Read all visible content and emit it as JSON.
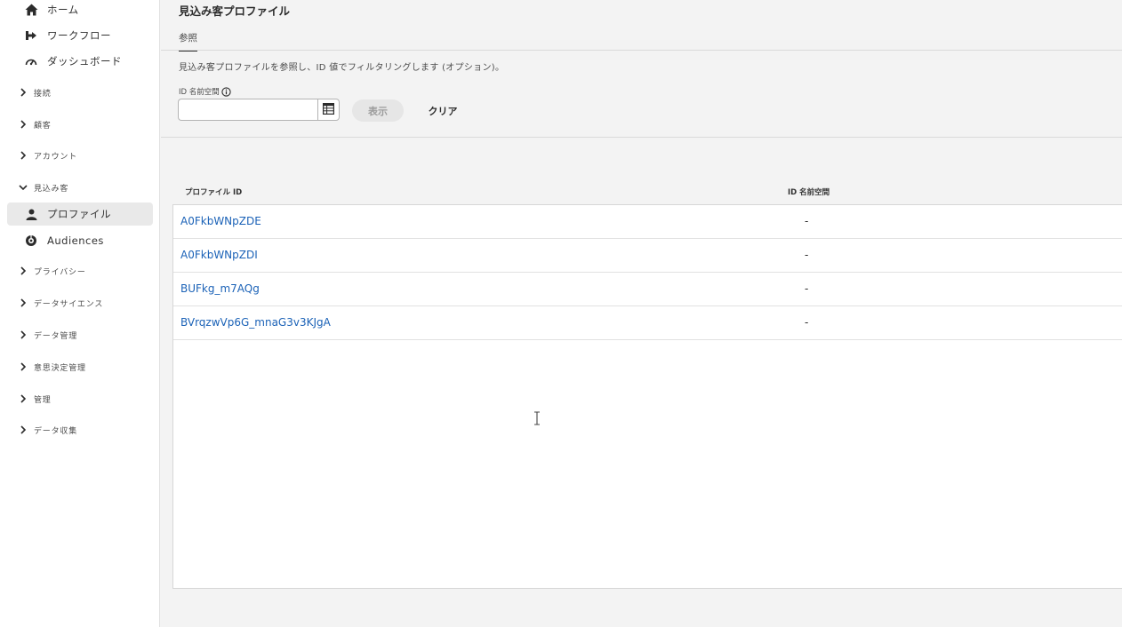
{
  "sidebar": {
    "top_items": [
      {
        "label": "ホーム",
        "icon": "home-icon"
      },
      {
        "label": "ワークフロー",
        "icon": "workflow-icon"
      },
      {
        "label": "ダッシュボード",
        "icon": "dashboard-icon"
      }
    ],
    "groups": [
      {
        "label": "接続",
        "expanded": false
      },
      {
        "label": "顧客",
        "expanded": false
      },
      {
        "label": "アカウント",
        "expanded": false
      },
      {
        "label": "見込み客",
        "expanded": true
      },
      {
        "label": "プライバシー",
        "expanded": false
      },
      {
        "label": "データサイエンス",
        "expanded": false
      },
      {
        "label": "データ管理",
        "expanded": false
      },
      {
        "label": "意思決定管理",
        "expanded": false
      },
      {
        "label": "管理",
        "expanded": false
      },
      {
        "label": "データ収集",
        "expanded": false
      }
    ],
    "sub_items": [
      {
        "label": "プロファイル",
        "icon": "user-icon",
        "selected": true
      },
      {
        "label": "Audiences",
        "icon": "audiences-icon",
        "selected": false
      }
    ]
  },
  "main": {
    "title": "見込み客プロファイル",
    "tab": "参照",
    "description": "見込み客プロファイルを参照し、ID 値でフィルタリングします (オプション)。",
    "filter": {
      "label": "ID 名前空間",
      "input_value": "",
      "show_button": "表示",
      "clear_button": "クリア"
    },
    "table": {
      "columns": [
        "プロファイル ID",
        "ID 名前空間"
      ],
      "rows": [
        {
          "id": "A0FkbWNpZDE",
          "namespace": "-"
        },
        {
          "id": "A0FkbWNpZDI",
          "namespace": "-"
        },
        {
          "id": "BUFkg_m7AQg",
          "namespace": "-"
        },
        {
          "id": "BVrqzwVp6G_mnaG3v3KJgA",
          "namespace": "-"
        }
      ]
    }
  },
  "colors": {
    "link": "#1b62b7",
    "sidebar_bg": "#ffffff",
    "main_bg": "#f3f3f3",
    "selected_bg": "#e9e9e9"
  }
}
